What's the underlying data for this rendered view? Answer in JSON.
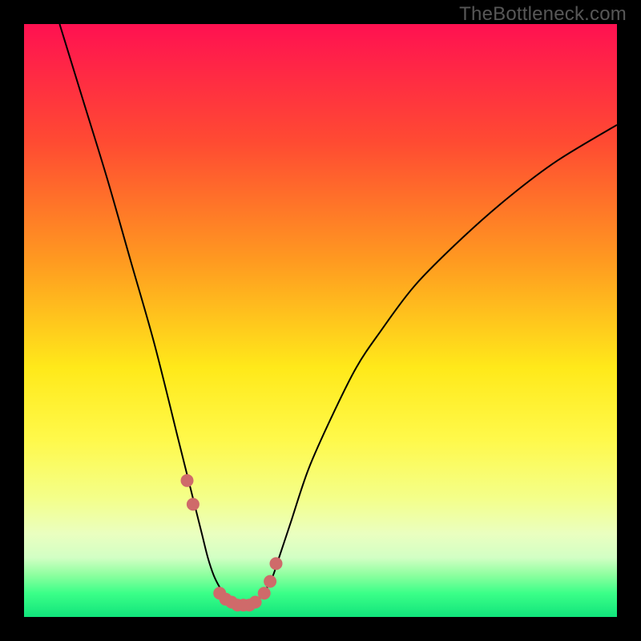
{
  "watermark": "TheBottleneck.com",
  "chart_data": {
    "type": "line",
    "title": "",
    "xlabel": "",
    "ylabel": "",
    "xlim": [
      0,
      100
    ],
    "ylim": [
      0,
      100
    ],
    "series": [
      {
        "name": "bottleneck-curve",
        "x": [
          6,
          10,
          14,
          18,
          22,
          26,
          27,
          28,
          29,
          30,
          31,
          32,
          33,
          34,
          35,
          36,
          37,
          38,
          39,
          40,
          41,
          42,
          43,
          44,
          45,
          48,
          52,
          56,
          60,
          66,
          74,
          82,
          90,
          100
        ],
        "values": [
          100,
          87,
          74,
          60,
          46,
          30,
          26,
          22,
          18,
          14,
          10,
          7,
          5,
          3.5,
          2.5,
          2,
          2,
          2,
          2.5,
          3.5,
          5,
          7,
          10,
          13,
          16,
          25,
          34,
          42,
          48,
          56,
          64,
          71,
          77,
          83
        ]
      }
    ],
    "markers": {
      "name": "highlight-dots",
      "x": [
        27.5,
        28.5,
        33,
        34,
        35,
        36,
        37,
        38,
        39,
        40.5,
        41.5,
        42.5
      ],
      "values": [
        23,
        19,
        4,
        3,
        2.5,
        2,
        2,
        2,
        2.5,
        4,
        6,
        9
      ],
      "color": "#cf6a6a",
      "radius": 8
    },
    "gradient_stops": [
      {
        "offset": 0.0,
        "color": "#ff1151"
      },
      {
        "offset": 0.2,
        "color": "#ff4b32"
      },
      {
        "offset": 0.4,
        "color": "#ff9a20"
      },
      {
        "offset": 0.58,
        "color": "#ffe91a"
      },
      {
        "offset": 0.7,
        "color": "#fff94a"
      },
      {
        "offset": 0.8,
        "color": "#f4ff8a"
      },
      {
        "offset": 0.86,
        "color": "#eaffc0"
      },
      {
        "offset": 0.9,
        "color": "#d2ffc4"
      },
      {
        "offset": 0.93,
        "color": "#8bff9e"
      },
      {
        "offset": 0.96,
        "color": "#3bff88"
      },
      {
        "offset": 1.0,
        "color": "#11e47b"
      }
    ]
  }
}
